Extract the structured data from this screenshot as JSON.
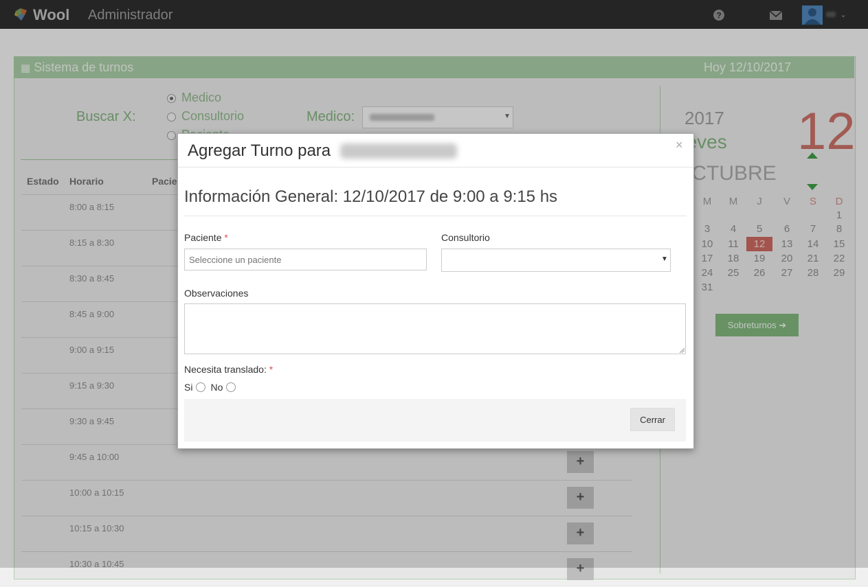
{
  "topbar": {
    "brand": "Wool",
    "title": "Administrador",
    "icons": [
      "help-icon",
      "mail-icon",
      "user-avatar-icon",
      "chevron-down-icon"
    ]
  },
  "panel": {
    "title": "Sistema de turnos",
    "date": "Hoy 12/10/2017",
    "icon": "calendar-icon",
    "accent": "#a7c9a4"
  },
  "search": {
    "label": "Buscar X:",
    "options": [
      "Medico",
      "Consultorio",
      "Paciente"
    ],
    "selected": "Medico",
    "medico_label": "Medico:"
  },
  "table": {
    "headers": [
      "Estado",
      "Horario",
      "Paciente"
    ],
    "slots": [
      "8:00 a 8:15",
      "8:15 a 8:30",
      "8:30 a 8:45",
      "8:45 a 9:00",
      "9:00 a 9:15",
      "9:15 a 9:30",
      "9:30 a 9:45",
      "9:45 a 10:00",
      "10:00 a 10:15",
      "10:15 a 10:30",
      "10:30 a 10:45"
    ],
    "add_label": "+"
  },
  "calendar": {
    "year": "2017",
    "weekday": "ueves",
    "month": "OCTUBRE",
    "big_day": "12",
    "headers": [
      "M",
      "M",
      "J",
      "V",
      "S",
      "D"
    ],
    "weeks": [
      [
        "",
        "",
        "",
        "",
        "",
        "1"
      ],
      [
        "3",
        "4",
        "5",
        "6",
        "7",
        "8"
      ],
      [
        "10",
        "11",
        "12",
        "13",
        "14",
        "15"
      ],
      [
        "17",
        "18",
        "19",
        "20",
        "21",
        "22"
      ],
      [
        "24",
        "25",
        "26",
        "27",
        "28",
        "29"
      ],
      [
        "31",
        "",
        "",
        "",
        "",
        ""
      ]
    ],
    "today": "12",
    "today_color": "#c6675f",
    "sobreturnos_label": "Sobreturnos"
  },
  "modal": {
    "title": "Agregar Turno para",
    "info": "Información General: 12/10/2017 de 9:00 a 9:15 hs",
    "paciente_label": "Paciente",
    "paciente_placeholder": "Seleccione un paciente",
    "consultorio_label": "Consultorio",
    "observaciones_label": "Observaciones",
    "traslado_label": "Necesita translado:",
    "required_mark": "*",
    "si_label": "Si",
    "no_label": "No",
    "close_button": "Cerrar",
    "close_icon": "×"
  }
}
